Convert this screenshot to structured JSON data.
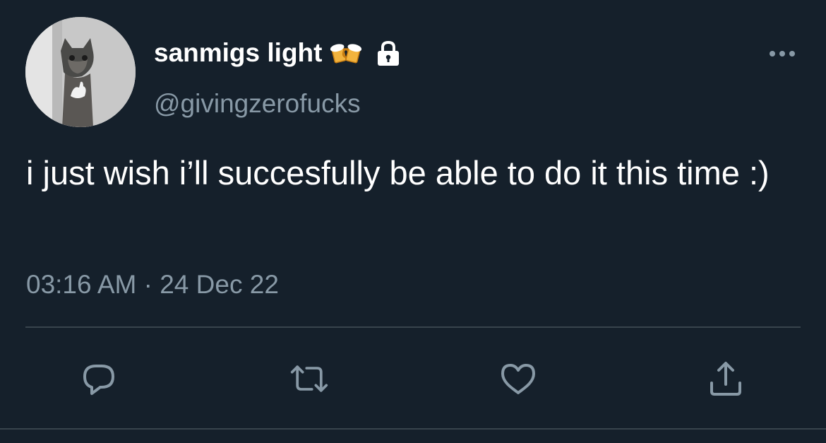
{
  "tweet": {
    "display_name": "sanmigs light",
    "name_emoji": "🍻",
    "handle": "@givingzerofucks",
    "text": "i just wish i’ll succesfully be able to do it this time :)",
    "time": "03:16 AM",
    "separator": "·",
    "date": "24 Dec 22"
  },
  "icons": {
    "more": "more-horizontal-icon",
    "lock": "lock-icon",
    "reply": "reply-icon",
    "retweet": "retweet-icon",
    "like": "heart-icon",
    "share": "share-icon"
  },
  "colors": {
    "background": "#15202b",
    "primary_text": "#ffffff",
    "secondary_text": "#8899a6",
    "divider": "#38444d"
  }
}
